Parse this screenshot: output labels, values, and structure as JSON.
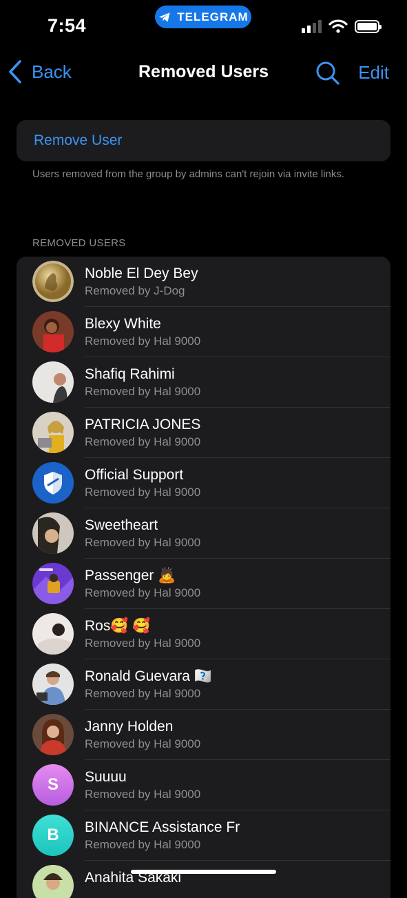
{
  "status": {
    "time": "7:54",
    "pill_label": "TELEGRAM",
    "accent": "#1677e8"
  },
  "nav": {
    "back_label": "Back",
    "title": "Removed Users",
    "edit_label": "Edit"
  },
  "remove_user_label": "Remove User",
  "footer_note": "Users removed from the group by admins can't rejoin via invite links.",
  "section_header": "REMOVED USERS",
  "users": [
    {
      "name": "Noble El Dey Bey",
      "sub": "Removed by J-Dog",
      "avatar": "coin-photo"
    },
    {
      "name": "Blexy White",
      "sub": "Removed by Hal 9000",
      "avatar": "photo"
    },
    {
      "name": "Shafiq Rahimi",
      "sub": "Removed by Hal 9000",
      "avatar": "photo"
    },
    {
      "name": "PATRICIA JONES",
      "sub": "Removed by Hal 9000",
      "avatar": "photo"
    },
    {
      "name": "Official Support",
      "sub": "Removed by Hal 9000",
      "avatar": "shield-icon"
    },
    {
      "name": "Sweetheart",
      "sub": "Removed by Hal 9000",
      "avatar": "photo"
    },
    {
      "name": "Passenger 🙇",
      "sub": "Removed by Hal 9000",
      "avatar": "photo"
    },
    {
      "name": "Ros🥰 🥰",
      "sub": "Removed by Hal 9000",
      "avatar": "photo"
    },
    {
      "name": "Ronald Guevara 🇶🇶",
      "sub": "Removed by Hal 9000",
      "avatar": "photo"
    },
    {
      "name": "Janny Holden",
      "sub": "Removed by Hal 9000",
      "avatar": "photo"
    },
    {
      "name": "Suuuu",
      "sub": "Removed by Hal 9000",
      "avatar": "initial",
      "initial": "S"
    },
    {
      "name": "BINANCE Assistance Fr",
      "sub": "Removed by Hal 9000",
      "avatar": "initial",
      "initial": "B"
    },
    {
      "name": "Anahita Sakaki",
      "sub": "",
      "avatar": "photo"
    }
  ]
}
